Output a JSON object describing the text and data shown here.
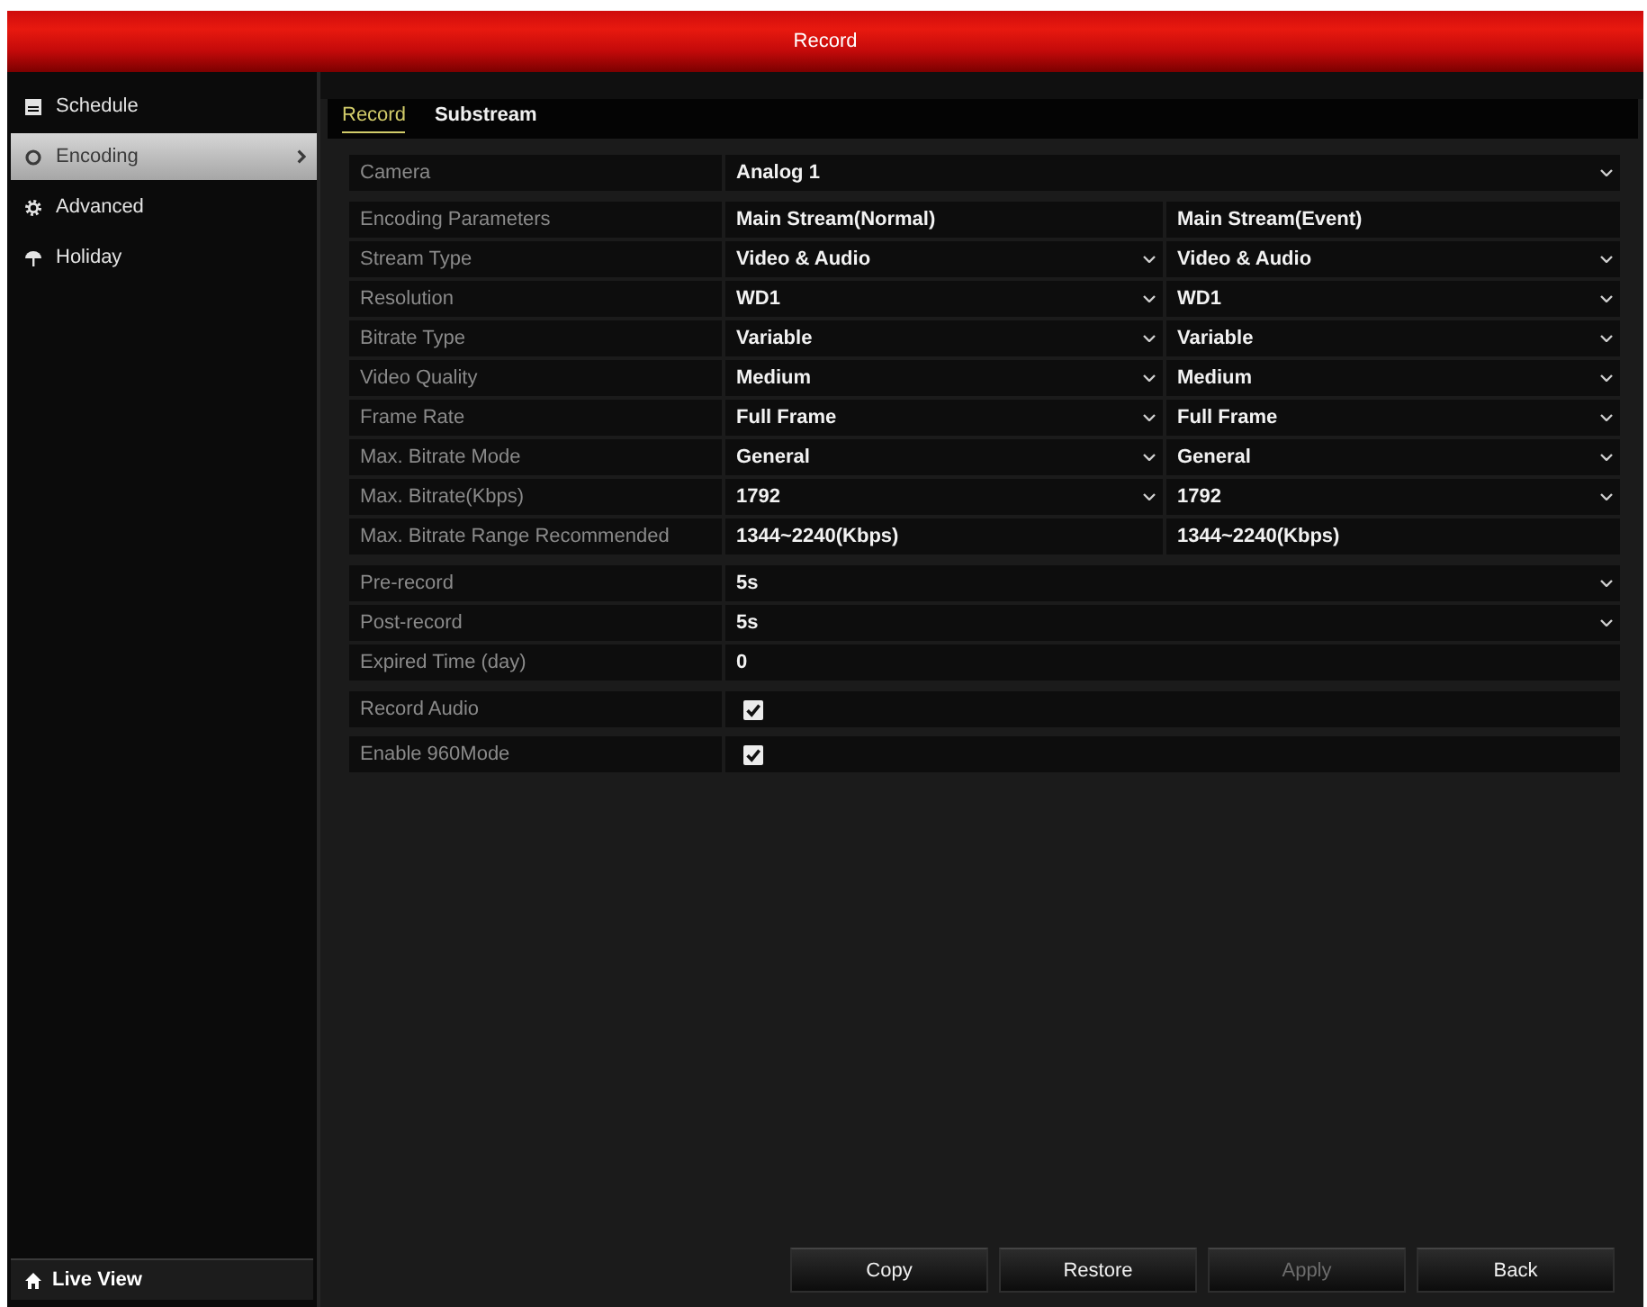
{
  "window": {
    "title": "Record"
  },
  "sidebar": {
    "items": [
      {
        "label": "Schedule",
        "selected": false
      },
      {
        "label": "Encoding",
        "selected": true
      },
      {
        "label": "Advanced",
        "selected": false
      },
      {
        "label": "Holiday",
        "selected": false
      }
    ],
    "footer_item": "Live View"
  },
  "tabs": [
    {
      "label": "Record",
      "selected": true
    },
    {
      "label": "Substream",
      "selected": false
    }
  ],
  "camera": {
    "label": "Camera",
    "kind": "dropdown",
    "value": "Analog 1"
  },
  "encoding": {
    "columns": [
      "Encoding Parameters",
      "Main Stream(Normal)",
      "Main Stream(Event)"
    ],
    "rows": [
      {
        "label": "Stream Type",
        "kind": "dropdown",
        "values": [
          "Video & Audio",
          "Video & Audio"
        ]
      },
      {
        "label": "Resolution",
        "kind": "dropdown",
        "values": [
          "WD1",
          "WD1"
        ]
      },
      {
        "label": "Bitrate Type",
        "kind": "dropdown",
        "values": [
          "Variable",
          "Variable"
        ]
      },
      {
        "label": "Video Quality",
        "kind": "dropdown",
        "values": [
          "Medium",
          "Medium"
        ]
      },
      {
        "label": "Frame Rate",
        "kind": "dropdown",
        "values": [
          "Full Frame",
          "Full Frame"
        ]
      },
      {
        "label": "Max. Bitrate Mode",
        "kind": "dropdown",
        "values": [
          "General",
          "General"
        ]
      },
      {
        "label": "Max. Bitrate(Kbps)",
        "kind": "dropdown",
        "values": [
          "1792",
          "1792"
        ]
      },
      {
        "label": "Max. Bitrate Range Recommended",
        "kind": "text",
        "values": [
          "1344~2240(Kbps)",
          "1344~2240(Kbps)"
        ]
      }
    ]
  },
  "record_settings": [
    {
      "label": "Pre-record",
      "kind": "dropdown",
      "value": "5s"
    },
    {
      "label": "Post-record",
      "kind": "dropdown",
      "value": "5s"
    },
    {
      "label": "Expired Time (day)",
      "kind": "input",
      "value": "0"
    }
  ],
  "options": [
    {
      "label": "Record Audio",
      "checked": true
    },
    {
      "label": "Enable 960Mode",
      "checked": true
    }
  ],
  "buttons": [
    {
      "label": "Copy",
      "disabled": false
    },
    {
      "label": "Restore",
      "disabled": false
    },
    {
      "label": "Apply",
      "disabled": true
    },
    {
      "label": "Back",
      "disabled": false
    }
  ]
}
